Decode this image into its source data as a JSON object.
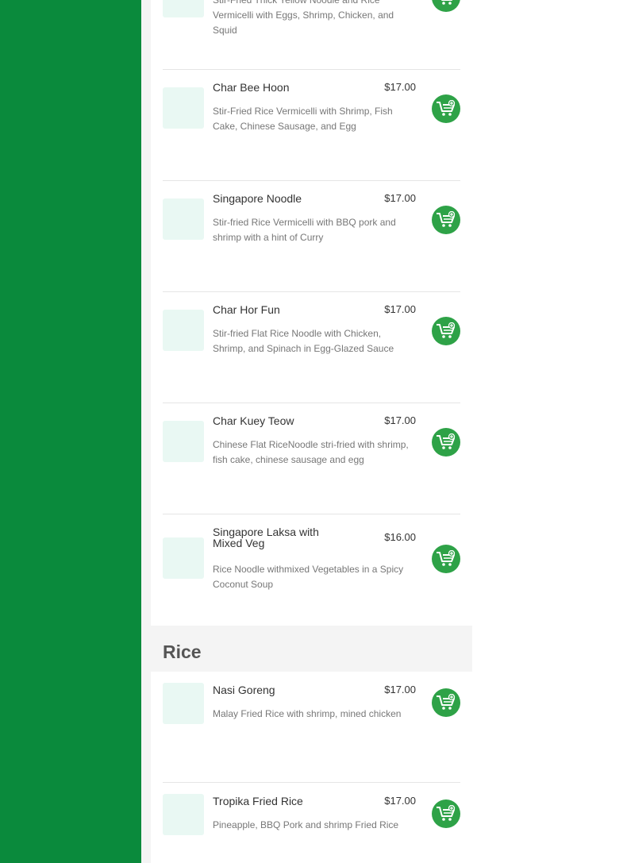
{
  "noodles": {
    "items": [
      {
        "name": "",
        "price": "",
        "desc": "Stir-Fried Thick Yellow Noodle and Rice Vermicelli with Eggs, Shrimp, Chicken, and Squid"
      },
      {
        "name": "Char Bee Hoon",
        "price": "$17.00",
        "desc": "Stir-Fried Rice Vermicelli with Shrimp, Fish Cake, Chinese Sausage, and Egg"
      },
      {
        "name": "Singapore Noodle",
        "price": "$17.00",
        "desc": "Stir-fried Rice Vermicelli with BBQ pork and shrimp with a hint of Curry"
      },
      {
        "name": "Char Hor Fun",
        "price": "$17.00",
        "desc": "Stir-fried Flat Rice Noodle with Chicken, Shrimp, and Spinach in Egg-Glazed Sauce"
      },
      {
        "name": "Char Kuey Teow",
        "price": "$17.00",
        "desc": "Chinese Flat RiceNoodle stri-fried with shrimp, fish cake, chinese sausage and egg"
      },
      {
        "name": "Singapore Laksa with Mixed Veg",
        "price": "$16.00",
        "desc": "Rice Noodle withmixed Vegetables in a Spicy Coconut Soup"
      }
    ]
  },
  "rice": {
    "title": "Rice",
    "items": [
      {
        "name": "Nasi Goreng",
        "price": "$17.00",
        "desc": "Malay Fried Rice with shrimp, mined chicken"
      },
      {
        "name": "Tropika Fried Rice",
        "price": "$17.00",
        "desc": "Pineapple, BBQ Pork and shrimp Fried Rice"
      }
    ]
  },
  "colors": {
    "sidebar": "#0a8a3c",
    "cart_button": "#2ea247",
    "thumb_placeholder": "#e9f8f3"
  },
  "icons": {
    "add_to_cart": "cart-plus-icon"
  }
}
